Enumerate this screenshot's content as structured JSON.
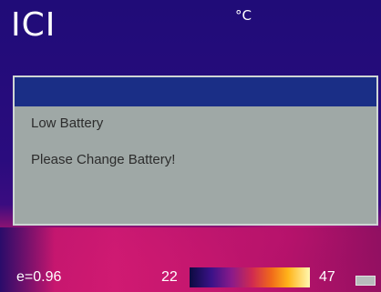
{
  "header": {
    "brand": "ICI",
    "unit": "°C"
  },
  "dialog": {
    "line1": "Low Battery",
    "line2": "Please Change Battery!"
  },
  "status_bar": {
    "emissivity": "e=0.96",
    "scale_min": "22",
    "scale_max": "47",
    "battery_icon": "battery-icon"
  },
  "colors": {
    "dialog_title": "#1a2e86",
    "dialog_body": "#9fa8a6"
  }
}
